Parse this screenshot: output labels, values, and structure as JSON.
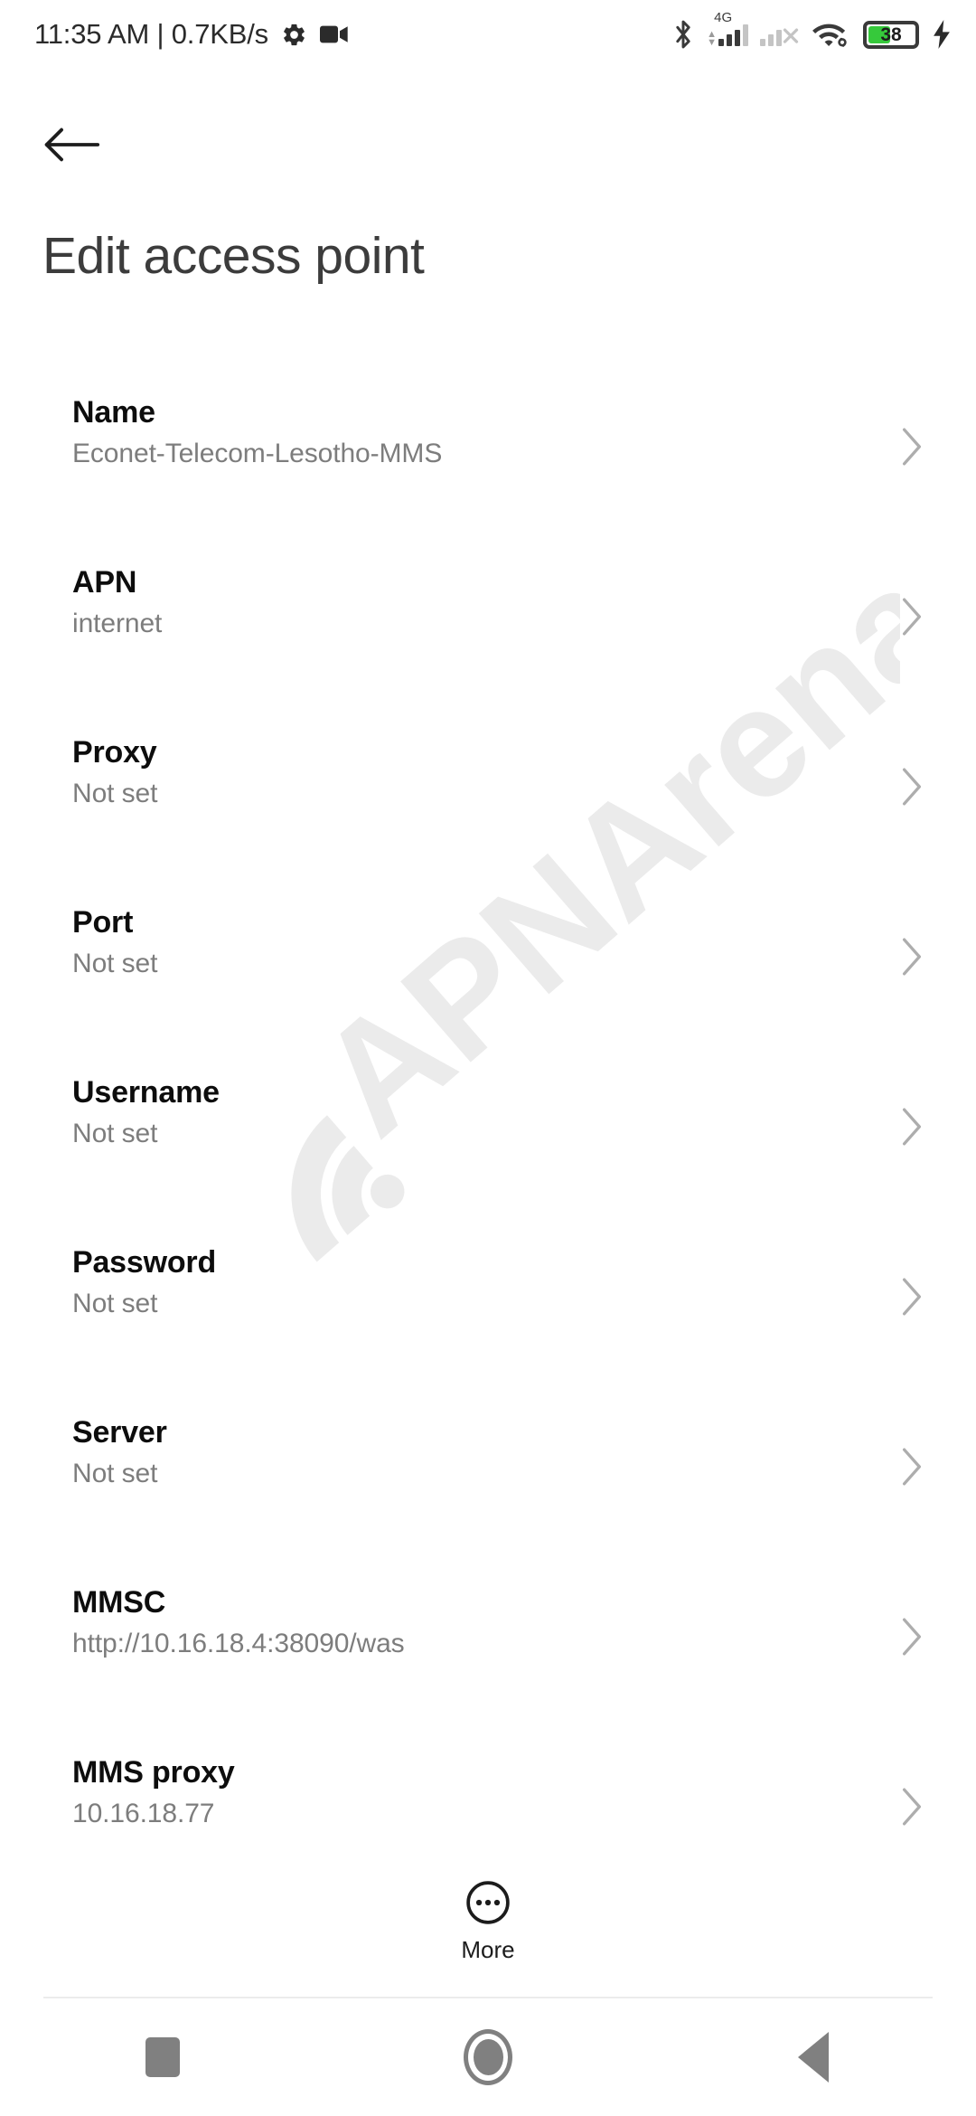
{
  "status_bar": {
    "clock_text": "11:35 AM | 0.7KB/s",
    "icons_left": [
      "gear-icon",
      "video-camera-icon"
    ],
    "bluetooth": "bluetooth-icon",
    "network_type": "4G",
    "sim1": "signal-bars-4g-icon",
    "sim2": "signal-no-service-icon",
    "wifi": "wifi-link-icon",
    "battery_percent": "38",
    "battery_fill_pct": 45,
    "battery_color": "#36c93b",
    "charging": "charging-bolt-icon"
  },
  "header": {
    "back_icon": "back-arrow-icon",
    "title": "Edit access point"
  },
  "settings": {
    "rows": [
      {
        "title": "Name",
        "value": "Econet-Telecom-Lesotho-MMS"
      },
      {
        "title": "APN",
        "value": "internet"
      },
      {
        "title": "Proxy",
        "value": "Not set"
      },
      {
        "title": "Port",
        "value": "Not set"
      },
      {
        "title": "Username",
        "value": "Not set"
      },
      {
        "title": "Password",
        "value": "Not set"
      },
      {
        "title": "Server",
        "value": "Not set"
      },
      {
        "title": "MMSC",
        "value": "http://10.16.18.4:38090/was"
      },
      {
        "title": "MMS proxy",
        "value": "10.16.18.77"
      }
    ]
  },
  "footer": {
    "more_label": "More",
    "more_icon": "more-circle-icon"
  },
  "navigation_bar": {
    "recents_label": "recents-square-icon",
    "home_label": "home-circle-icon",
    "back_label": "back-triangle-icon"
  },
  "watermark": {
    "text": "APNArena",
    "color": "#ebebeb"
  }
}
